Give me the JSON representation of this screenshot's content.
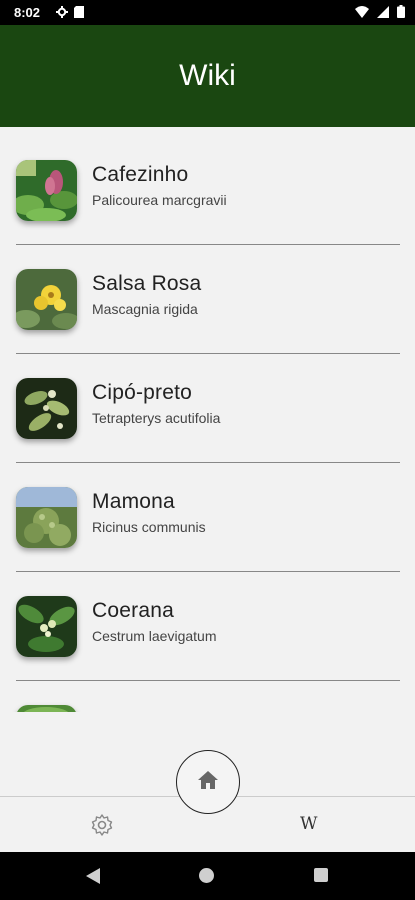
{
  "status_bar": {
    "time": "8:02"
  },
  "app_bar": {
    "title": "Wiki"
  },
  "plants": [
    {
      "name": "Cafezinho",
      "scientific": "Palicourea marcgravii"
    },
    {
      "name": "Salsa Rosa",
      "scientific": "Mascagnia rigida"
    },
    {
      "name": "Cipó-preto",
      "scientific": "Tetrapterys acutifolia"
    },
    {
      "name": "Mamona",
      "scientific": "Ricinus communis"
    },
    {
      "name": "Coerana",
      "scientific": "Cestrum laevigatum"
    }
  ],
  "bottom_nav": {
    "wiki_label": "W"
  },
  "colors": {
    "app_bar": "#1a4711",
    "background": "#f2f2f2"
  }
}
